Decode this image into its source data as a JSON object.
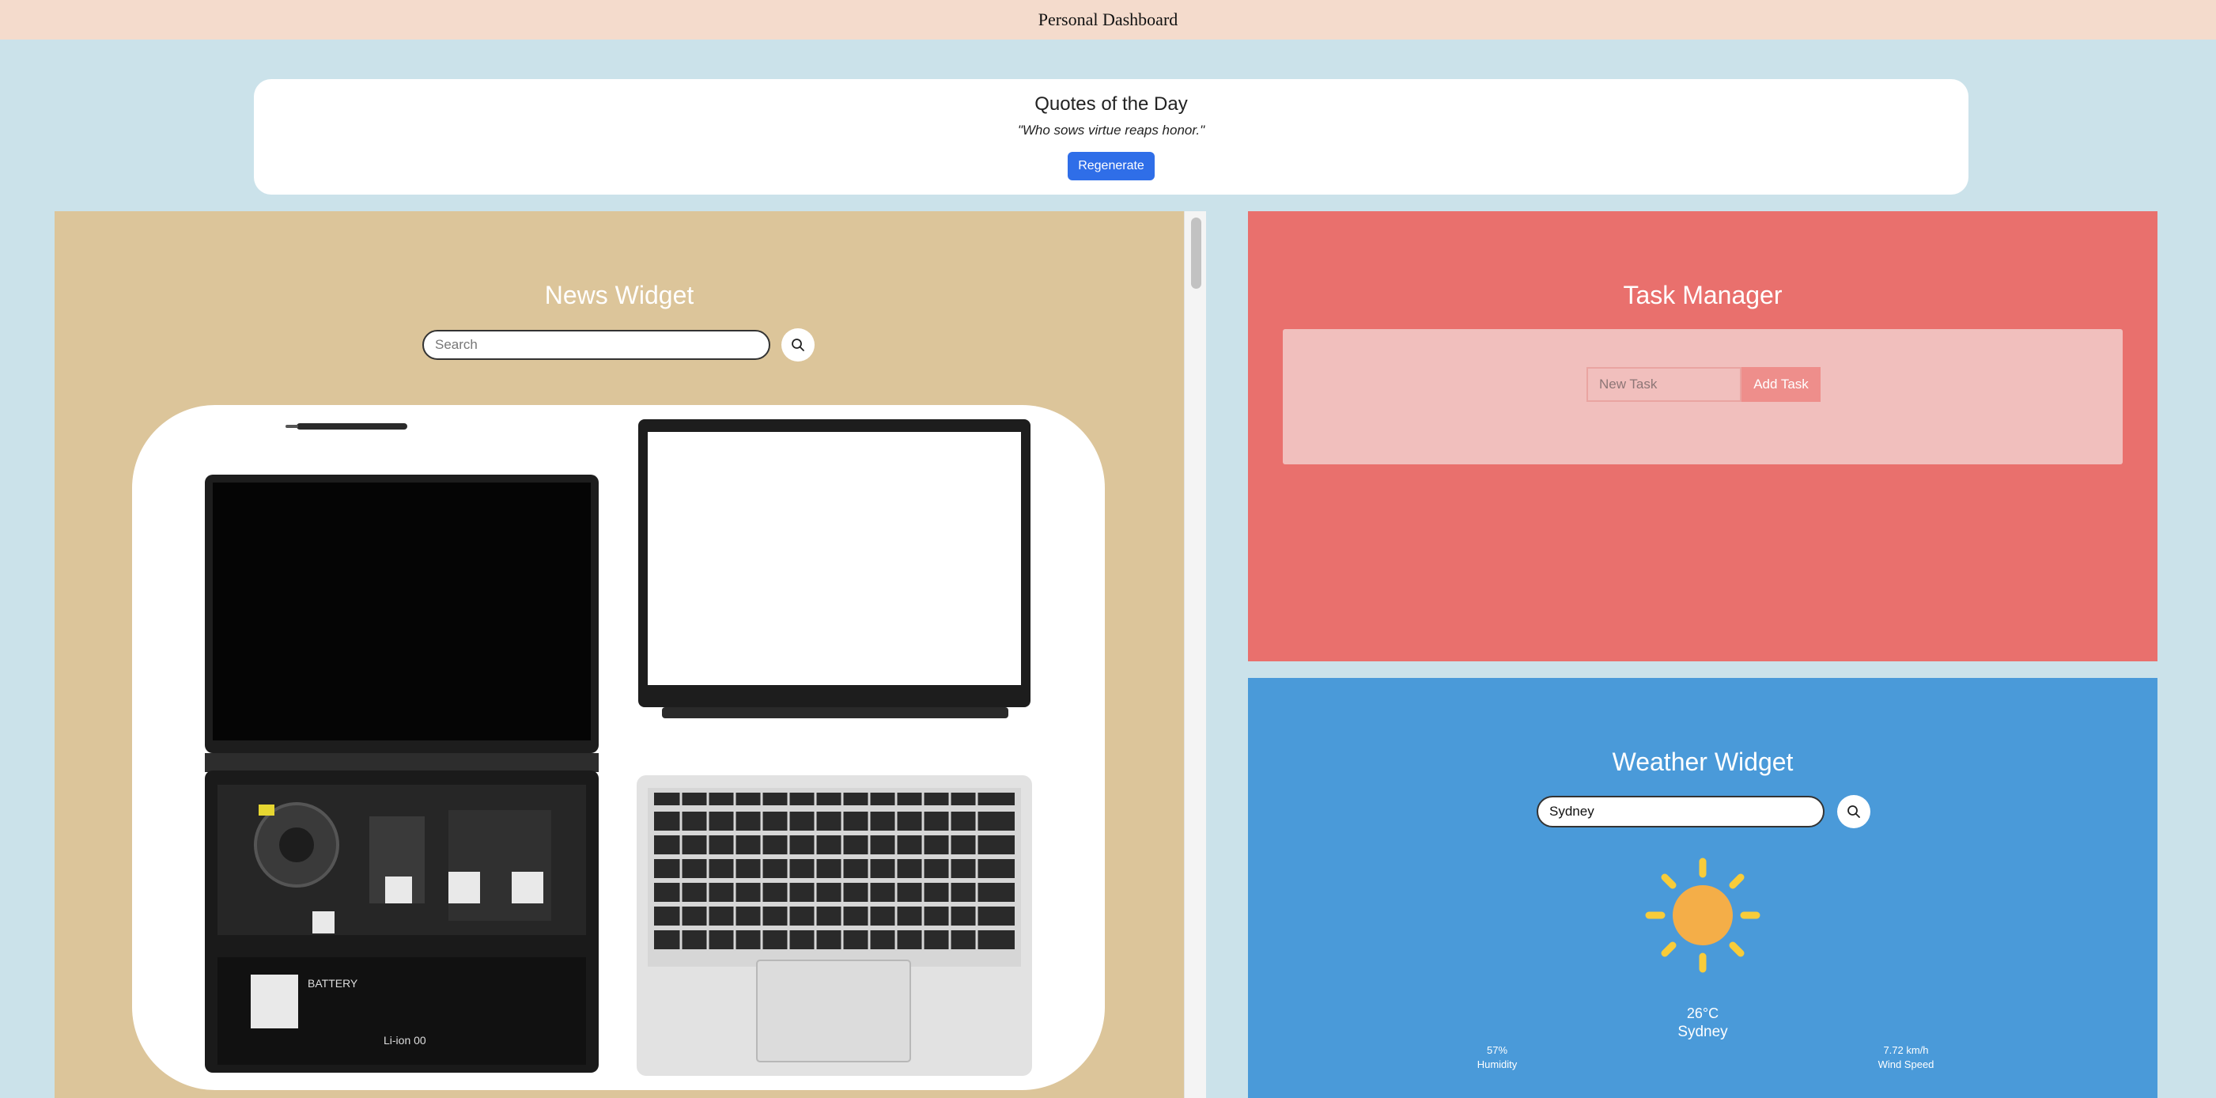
{
  "header": {
    "title": "Personal Dashboard"
  },
  "quote": {
    "heading": "Quotes of the Day",
    "text": "\"Who sows virtue reaps honor.\"",
    "button_label": "Regenerate"
  },
  "news": {
    "title": "News Widget",
    "search_placeholder": "Search",
    "image_icon": "laptop-parts-image"
  },
  "tasks": {
    "title": "Task Manager",
    "input_placeholder": "New Task",
    "add_label": "Add Task"
  },
  "weather": {
    "title": "Weather Widget",
    "city_input": "Sydney",
    "icon": "sun-icon",
    "temperature": "26°C",
    "city": "Sydney",
    "humidity_value": "57%",
    "humidity_label": "Humidity",
    "wind_value": "7.72 km/h",
    "wind_label": "Wind Speed"
  },
  "colors": {
    "header_bg": "#f4dbcc",
    "page_bg": "#cbe2ea",
    "news_bg": "#dcc59a",
    "task_bg": "#e9706d",
    "weather_bg": "#4a9ad9",
    "accent_button": "#2f6ee8"
  }
}
